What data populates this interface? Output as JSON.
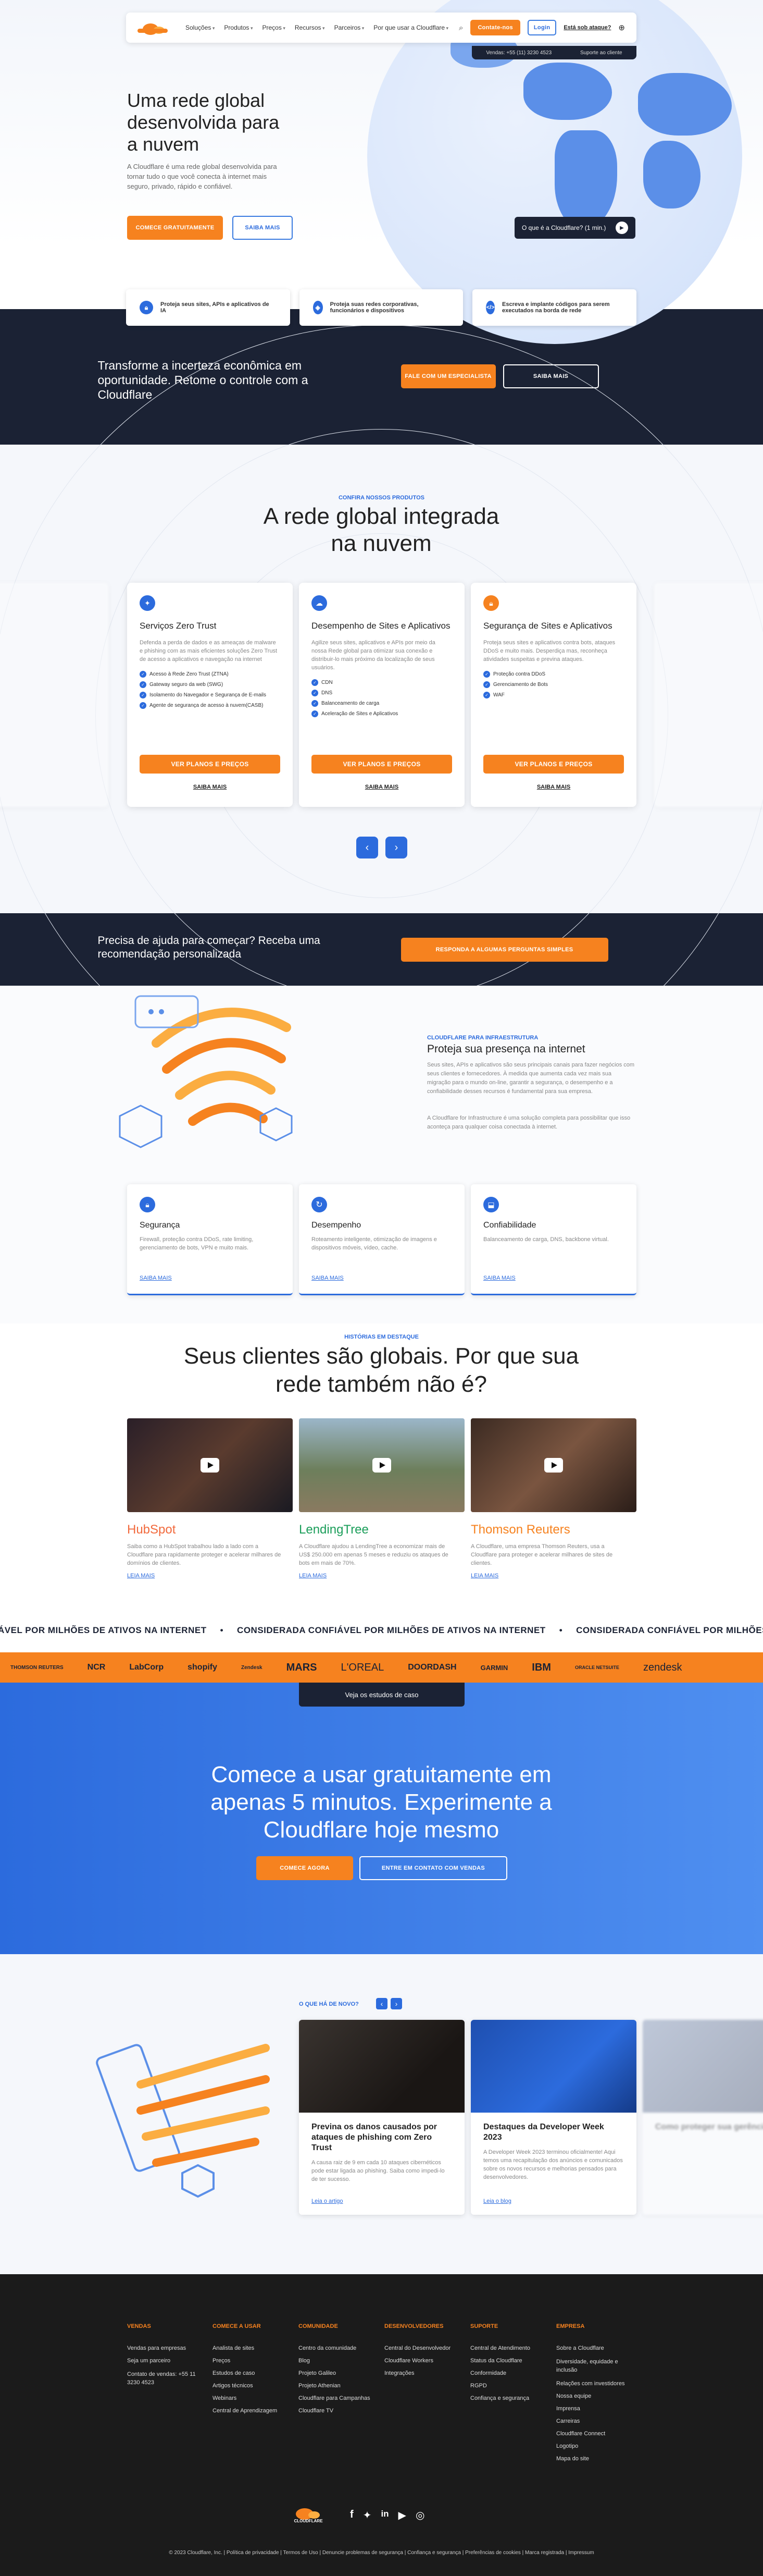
{
  "nav": {
    "items": [
      "Soluções",
      "Produtos",
      "Preços",
      "Recursos",
      "Parceiros"
    ],
    "why": "Por que usar a Cloudflare",
    "contact": "Contate-nos",
    "login": "Login",
    "attack": "Está sob ataque?",
    "sales": "Vendas: +55 (11) 3230 4523",
    "support": "Suporte ao cliente"
  },
  "hero": {
    "title": "Uma rede global desenvolvida para a nuvem",
    "lead": "A Cloudflare é uma rede global desenvolvida para tornar tudo o que você conecta à internet mais seguro, privado, rápido e confiável.",
    "cta_primary": "COMECE GRATUITAMENTE",
    "cta_secondary": "SAIBA MAIS",
    "video": "O que é a Cloudflare? (1 min.)"
  },
  "features": [
    "Proteja seus sites, APIs e aplicativos de IA",
    "Proteja suas redes corporativas, funcionários e dispositivos",
    "Escreva e implante códigos para serem executados na borda de rede"
  ],
  "band1": {
    "text": "Transforme a incerteza econômica em oportunidade. Retome o controle com a Cloudflare",
    "primary": "FALE COM UM ESPECIALISTA",
    "secondary": "SAIBA MAIS"
  },
  "platform": {
    "eyebrow": "CONFIRA NOSSOS PRODUTOS",
    "title": "A rede global integrada na nuvem",
    "cards": [
      {
        "title": "Serviços Zero Trust",
        "desc": "Defenda a perda de dados e as ameaças de malware e phishing com as mais eficientes soluções Zero Trust de acesso a aplicativos e navegação na internet",
        "items": [
          "Acesso à Rede Zero Trust (ZTNA)",
          "Gateway seguro da web (SWG)",
          "Isolamento do Navegador e Segurança de E-mails",
          "Agente de segurança de acesso à nuvem(CASB)"
        ],
        "btn": "VER PLANOS E PREÇOS",
        "more": "SAIBA MAIS"
      },
      {
        "title": "Desempenho de Sites e Aplicativos",
        "desc": "Agilize seus sites, aplicativos e APIs por meio da nossa Rede global para otimizar sua conexão e distribuir-lo mais próximo da localização de seus usuários.",
        "items": [
          "CDN",
          "DNS",
          "Balanceamento de carga",
          "Aceleração de Sites e Aplicativos"
        ],
        "btn": "VER PLANOS E PREÇOS",
        "more": "SAIBA MAIS"
      },
      {
        "title": "Segurança de Sites e Aplicativos",
        "desc": "Proteja seus sites e aplicativos contra bots, ataques DDoS e muito mais. Desperdiça mas, reconheça atividades suspeitas e previna ataques.",
        "items": [
          "Proteção contra DDoS",
          "Gerenciamento de Bots",
          "WAF"
        ],
        "btn": "VER PLANOS E PREÇOS",
        "more": "SAIBA MAIS"
      }
    ]
  },
  "band2": {
    "text": "Precisa de ajuda para começar? Receba uma recomendação personalizada",
    "btn": "RESPONDA A ALGUMAS PERGUNTAS SIMPLES"
  },
  "infra": {
    "eyebrow": "CLOUDFLARE PARA INFRAESTRUTURA",
    "title": "Proteja sua presença na internet",
    "p1": "Seus sites, APIs e aplicativos são seus principais canais para fazer negócios com seus clientes e fornecedores. À medida que aumenta cada vez mais sua migração para o mundo on-line, garantir a segurança, o desempenho e a confiabilidade desses recursos é fundamental para sua empresa.",
    "p2": "A Cloudflare for Infrastructure é uma solução completa para possibilitar que isso aconteça para qualquer coisa conectada à internet.",
    "cards": [
      {
        "title": "Segurança",
        "desc": "Firewall, proteção contra DDoS, rate limiting, gerenciamento de bots, VPN e muito mais.",
        "link": "SAIBA MAIS"
      },
      {
        "title": "Desempenho",
        "desc": "Roteamento inteligente, otimização de imagens e dispositivos móveis, vídeo, cache.",
        "link": "SAIBA MAIS"
      },
      {
        "title": "Confiabilidade",
        "desc": "Balanceamento de carga, DNS, backbone virtual.",
        "link": "SAIBA MAIS"
      }
    ]
  },
  "customers": {
    "eyebrow": "HISTÓRIAS EM DESTAQUE",
    "title": "Seus clientes são globais. Por que sua rede também não é?",
    "items": [
      {
        "logo": "HubSpot",
        "desc": "Saiba como a HubSpot trabalhou lado a lado com a Cloudflare para rapidamente proteger e acelerar milhares de domínios de clientes.",
        "link": "LEIA MAIS"
      },
      {
        "logo": "LendingTree",
        "desc": "A Cloudflare ajudou a LendingTree a economizar mais de US$ 250.000 em apenas 5 meses e reduziu os ataques de bots em mais de 70%.",
        "link": "LEIA MAIS"
      },
      {
        "logo": "Thomson Reuters",
        "desc": "A Cloudflare, uma empresa Thomson Reuters, usa a Cloudflare para proteger e acelerar milhares de sites de clientes.",
        "link": "LEIA MAIS"
      }
    ]
  },
  "marquee": "CONSIDERADA CONFIÁVEL POR MILHÕES DE ATIVOS NA INTERNET",
  "marquee_lead": "ÁVEL POR MILHÕES DE ATIVOS NA INTERNET",
  "marquee_tail": "CONSIDERADA CONFIÁVEL POR MILHÕES DE ATIVOS NA INTERNET",
  "logos": [
    "THOMSON REUTERS",
    "NCR",
    "LabCorp",
    "shopify",
    "Zendesk",
    "MARS",
    "L'OREAL",
    "DOORDASH",
    "GARMIN",
    "IBM",
    "ORACLE NETSUITE",
    "zendesk"
  ],
  "cases_btn": "Veja os estudos de caso",
  "cta": {
    "title": "Comece a usar gratuitamente em apenas 5 minutos. Experimente a Cloudflare hoje mesmo",
    "primary": "COMECE AGORA",
    "secondary": "ENTRE EM CONTATO COM VENDAS"
  },
  "news": {
    "eyebrow": "O QUE HÁ DE NOVO?",
    "items": [
      {
        "title": "Previna os danos causados por ataques de phishing com Zero Trust",
        "desc": "A causa raiz de 9 em cada 10 ataques cibernéticos pode estar ligada ao phishing. Saiba como impedi-lo de ter sucesso.",
        "link": "Leia o artigo"
      },
      {
        "title": "Destaques da Developer Week 2023",
        "desc": "A Developer Week 2023 terminou oficialmente! Aqui temos uma recapitulação dos anúncios e comunicados sobre os novos recursos e melhorias pensados para desenvolvedores.",
        "link": "Leia o blog"
      },
      {
        "title": "Como proteger sua gerência",
        "desc": "",
        "link": ""
      }
    ]
  },
  "footer": {
    "cols": [
      {
        "h": "VENDAS",
        "items": [
          "Vendas para empresas",
          "Seja um parceiro",
          "Contato de vendas: +55 11 3230 4523"
        ]
      },
      {
        "h": "COMECE A USAR",
        "items": [
          "Analista de sites",
          "Preços",
          "Estudos de caso",
          "Artigos técnicos",
          "Webinars",
          "Central de Aprendizagem"
        ]
      },
      {
        "h": "COMUNIDADE",
        "items": [
          "Centro da comunidade",
          "Blog",
          "Projeto Galileo",
          "Projeto Athenian",
          "Cloudflare para Campanhas",
          "Cloudflare TV"
        ]
      },
      {
        "h": "DESENVOLVEDORES",
        "items": [
          "Central do Desenvolvedor",
          "Cloudflare Workers",
          "Integrações"
        ]
      },
      {
        "h": "SUPORTE",
        "items": [
          "Central de Atendimento",
          "Status da Cloudflare",
          "Conformidade",
          "RGPD",
          "Confiança e segurança"
        ]
      },
      {
        "h": "EMPRESA",
        "items": [
          "Sobre a Cloudflare",
          "Diversidade, equidade e inclusão",
          "Relações com investidores",
          "Nossa equipe",
          "Imprensa",
          "Carreiras",
          "Cloudflare Connect",
          "Logotipo",
          "Mapa do site"
        ]
      }
    ],
    "brand": "CLOUDFLARE",
    "legal": "© 2023 Cloudflare, Inc. | Política de privacidade | Termos de Uso | Denuncie problemas de segurança | Confiança e segurança | Preferências de cookies | Marca registrada | Impressum"
  }
}
